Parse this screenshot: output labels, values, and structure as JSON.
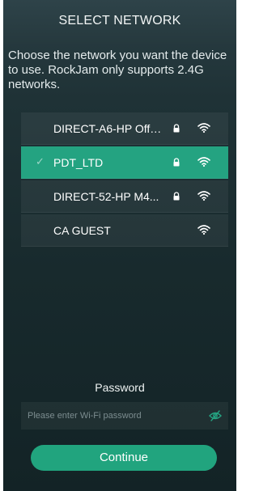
{
  "header": {
    "title": "SELECT NETWORK"
  },
  "instructions": "Choose the network you want the device to use. RockJam only supports 2.4G networks.",
  "networks": [
    {
      "ssid": "DIRECT-A6-HP Offi...",
      "secured": true,
      "selected": false,
      "icon": "wifi-icon"
    },
    {
      "ssid": "PDT_LTD",
      "secured": true,
      "selected": true,
      "icon": "wifi-icon"
    },
    {
      "ssid": "DIRECT-52-HP M4...",
      "secured": true,
      "selected": false,
      "icon": "wifi-icon"
    },
    {
      "ssid": "CA GUEST",
      "secured": false,
      "selected": false,
      "icon": "wifi-icon"
    }
  ],
  "selected_marker": "✓",
  "password": {
    "label": "Password",
    "placeholder": "Please enter Wi-Fi password",
    "value": "",
    "toggle_icon": "eye-off-icon"
  },
  "continue_label": "Continue",
  "colors": {
    "accent": "#21a47e",
    "selected_row": "#24a381",
    "background": "#1b2d30"
  }
}
